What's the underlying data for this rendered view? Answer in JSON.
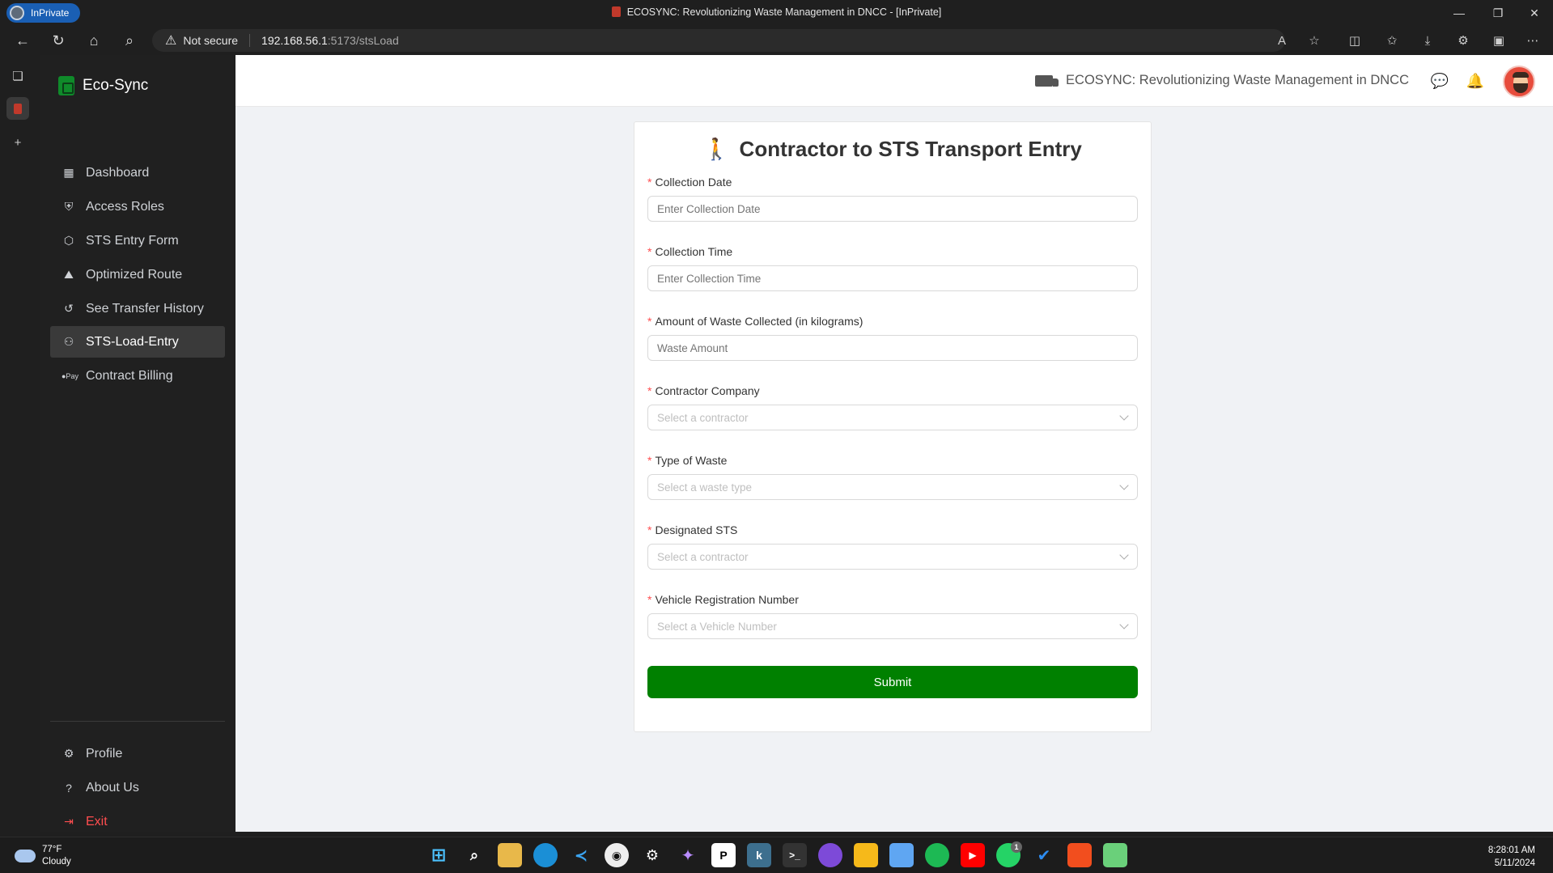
{
  "browser": {
    "profile_label": "InPrivate",
    "window_title": "ECOSYNC: Revolutionizing Waste Management in DNCC - [InPrivate]",
    "security_label": "Not secure",
    "url_host": "192.168.56.1",
    "url_path": ":5173/stsLoad"
  },
  "sidebar": {
    "brand": "Eco-Sync",
    "items": [
      {
        "label": "Dashboard",
        "icon": "dashboard-icon"
      },
      {
        "label": "Access Roles",
        "icon": "shield-icon"
      },
      {
        "label": "STS Entry Form",
        "icon": "cube-icon"
      },
      {
        "label": "Optimized Route",
        "icon": "map-icon"
      },
      {
        "label": "See Transfer History",
        "icon": "history-icon"
      },
      {
        "label": "STS-Load-Entry",
        "icon": "users-icon",
        "active": true
      },
      {
        "label": "Contract Billing",
        "icon": "pay-icon"
      }
    ],
    "bottom_items": [
      {
        "label": "Profile",
        "icon": "gear-icon"
      },
      {
        "label": "About Us",
        "icon": "question-icon"
      },
      {
        "label": "Exit",
        "icon": "logout-icon"
      }
    ]
  },
  "header": {
    "title": "ECOSYNC: Revolutionizing Waste Management in DNCC"
  },
  "form": {
    "title": "Contractor to STS Transport Entry",
    "fields": [
      {
        "label": "Collection Date",
        "placeholder": "Enter Collection Date",
        "type": "input"
      },
      {
        "label": "Collection Time",
        "placeholder": "Enter Collection Time",
        "type": "input"
      },
      {
        "label": "Amount of Waste Collected (in kilograms)",
        "placeholder": "Waste Amount",
        "type": "input"
      },
      {
        "label": "Contractor Company",
        "placeholder": "Select a contractor",
        "type": "select"
      },
      {
        "label": "Type of Waste",
        "placeholder": "Select a waste type",
        "type": "select"
      },
      {
        "label": "Designated STS",
        "placeholder": "Select a contractor",
        "type": "select"
      },
      {
        "label": "Vehicle Registration Number",
        "placeholder": "Select a Vehicle Number",
        "type": "select"
      }
    ],
    "submit_label": "Submit",
    "required_marker": "*"
  },
  "taskbar": {
    "temperature": "77°F",
    "condition": "Cloudy",
    "time": "8:28:01 AM",
    "date": "5/11/2024",
    "whatsapp_badge": "1"
  },
  "colors": {
    "accent_green": "#008000",
    "sidebar_bg": "#202020",
    "required_red": "#ff4d4f"
  }
}
